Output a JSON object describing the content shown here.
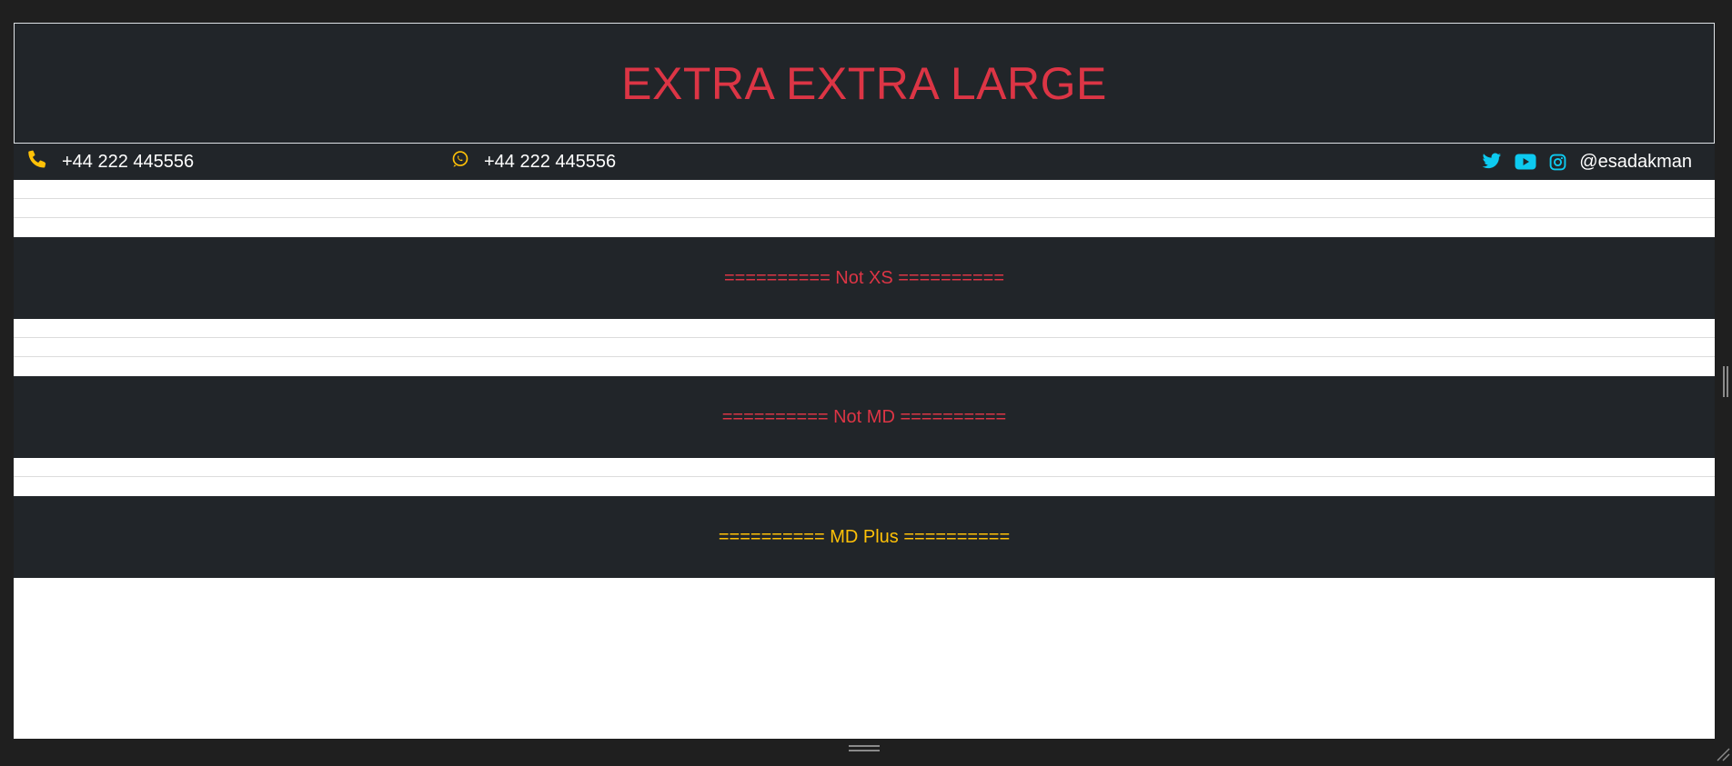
{
  "banner": {
    "title": "EXTRA EXTRA LARGE"
  },
  "topbar": {
    "phone": {
      "icon": "phone-icon",
      "number": "+44 222 445556"
    },
    "whatsapp": {
      "icon": "whatsapp-icon",
      "number": "+44 222 445556"
    },
    "social": {
      "icons": [
        "twitter-icon",
        "youtube-icon",
        "instagram-icon"
      ],
      "handle": "@esadakman"
    }
  },
  "sections": [
    {
      "text": "========== Not XS ==========",
      "color": "#dc3545"
    },
    {
      "text": "========== Not MD ==========",
      "color": "#dc3545"
    },
    {
      "text": "========== MD Plus ==========",
      "color": "#ffc107"
    }
  ],
  "colors": {
    "dark": "#212529",
    "red": "#dc3545",
    "yellow": "#ffc107",
    "social_blue": "#0dcaf0"
  }
}
